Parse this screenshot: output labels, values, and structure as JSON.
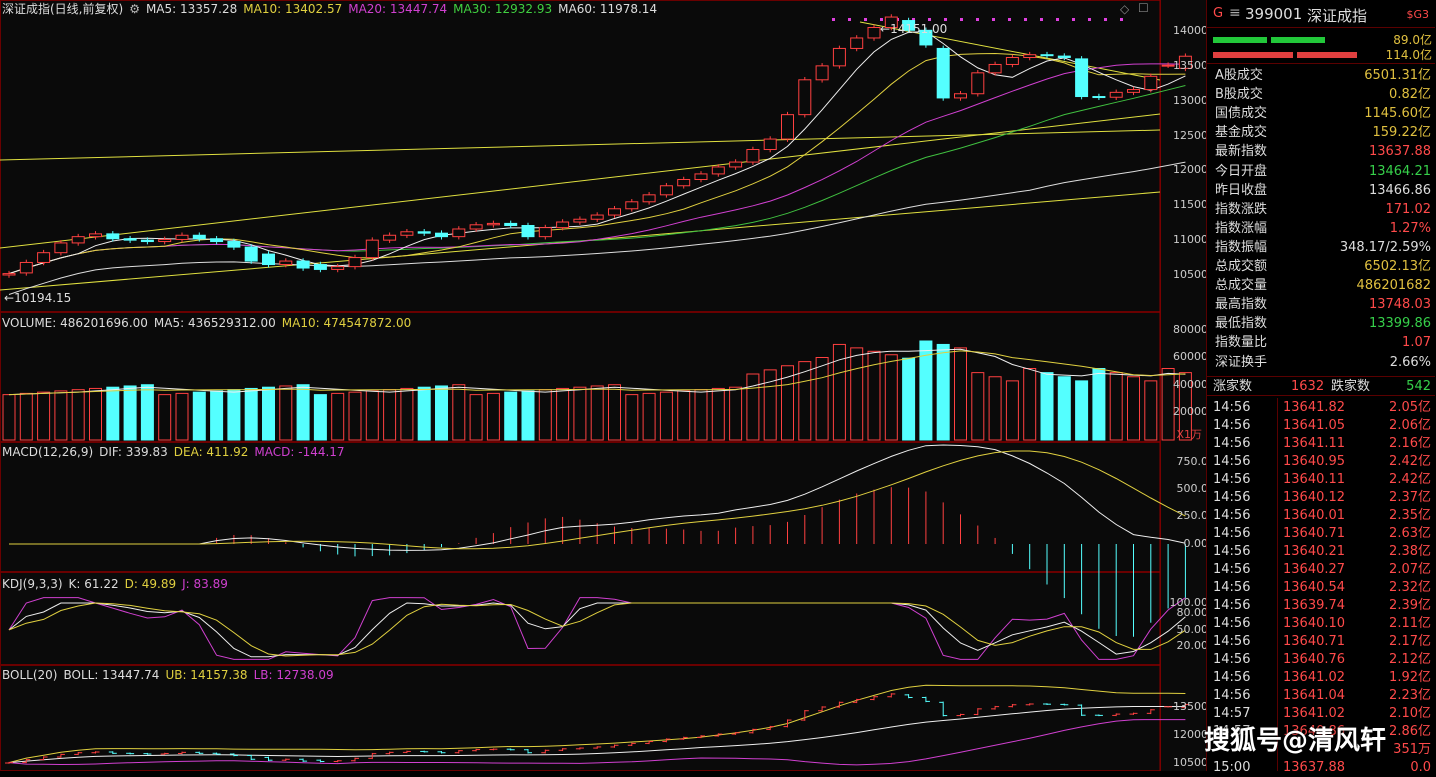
{
  "title": {
    "name": "深证成指(日线,前复权)",
    "ma5": "MA5: 13357.28",
    "ma10": "MA10: 13402.57",
    "ma20": "MA20: 13447.74",
    "ma30": "MA30: 12932.93",
    "ma60": "MA60: 11978.14"
  },
  "price_axis": [
    "14000",
    "13500",
    "13000",
    "12500",
    "12000",
    "11500",
    "11000",
    "10500"
  ],
  "high_label": "14151.00",
  "low_label": "10194.15",
  "volume": {
    "title": "VOLUME: 486201696.00",
    "ma5": "MA5: 436529312.00",
    "ma10": "MA10: 474547872.00",
    "axis": [
      "80000",
      "60000",
      "40000",
      "20000"
    ],
    "unit": "X1万"
  },
  "macd": {
    "title": "MACD(12,26,9)",
    "dif": "DIF: 339.83",
    "dea": "DEA: 411.92",
    "macd": "MACD: -144.17",
    "axis": [
      "750.0",
      "500.0",
      "250.0",
      "0.00"
    ]
  },
  "kdj": {
    "title": "KDJ(9,3,3)",
    "k": "K: 61.22",
    "d": "D: 49.89",
    "j": "J: 83.89",
    "axis": [
      "100.00",
      "80.00",
      "50.00",
      "20.00"
    ]
  },
  "boll": {
    "title": "BOLL(20)",
    "boll": "BOLL: 13447.74",
    "ub": "UB: 14157.38",
    "lb": "LB: 12738.09",
    "axis": [
      "13500",
      "12000",
      "10500"
    ]
  },
  "side": {
    "header": {
      "g": "G",
      "menu": "≡",
      "code": "399001",
      "name": "深证成指",
      "badge": "$G3"
    },
    "bars": {
      "top": "89.0亿",
      "bottom": "114.0亿"
    },
    "stats": [
      {
        "k": "A股成交",
        "v": "6501.31亿",
        "c": "#e0c040"
      },
      {
        "k": "B股成交",
        "v": "0.82亿",
        "c": "#e0c040"
      },
      {
        "k": "国债成交",
        "v": "1145.60亿",
        "c": "#e0c040"
      },
      {
        "k": "基金成交",
        "v": "159.22亿",
        "c": "#e0c040"
      },
      {
        "k": "最新指数",
        "v": "13637.88",
        "c": "#ff4a4a"
      },
      {
        "k": "今日开盘",
        "v": "13464.21",
        "c": "#36d04a"
      },
      {
        "k": "昨日收盘",
        "v": "13466.86",
        "c": "#ddd"
      },
      {
        "k": "指数涨跌",
        "v": "171.02",
        "c": "#ff4a4a"
      },
      {
        "k": "指数涨幅",
        "v": "1.27%",
        "c": "#ff4a4a"
      },
      {
        "k": "指数振幅",
        "v": "348.17/2.59%",
        "c": "#ddd"
      },
      {
        "k": "总成交额",
        "v": "6502.13亿",
        "c": "#e0c040"
      },
      {
        "k": "总成交量",
        "v": "486201682",
        "c": "#e0c040"
      },
      {
        "k": "最高指数",
        "v": "13748.03",
        "c": "#ff4a4a"
      },
      {
        "k": "最低指数",
        "v": "13399.86",
        "c": "#36d04a"
      },
      {
        "k": "指数量比",
        "v": "1.07",
        "c": "#ff4a4a"
      },
      {
        "k": "深证换手",
        "v": "2.66%",
        "c": "#ddd"
      }
    ],
    "updown": {
      "up_label": "涨家数",
      "up": "1632",
      "down_label": "跌家数",
      "down": "542"
    },
    "ticks": [
      [
        "14:56",
        "13641.82",
        "2.05亿"
      ],
      [
        "14:56",
        "13641.05",
        "2.06亿"
      ],
      [
        "14:56",
        "13641.11",
        "2.16亿"
      ],
      [
        "14:56",
        "13640.95",
        "2.42亿"
      ],
      [
        "14:56",
        "13640.11",
        "2.42亿"
      ],
      [
        "14:56",
        "13640.12",
        "2.37亿"
      ],
      [
        "14:56",
        "13640.01",
        "2.35亿"
      ],
      [
        "14:56",
        "13640.71",
        "2.63亿"
      ],
      [
        "14:56",
        "13640.21",
        "2.38亿"
      ],
      [
        "14:56",
        "13640.27",
        "2.07亿"
      ],
      [
        "14:56",
        "13640.54",
        "2.32亿"
      ],
      [
        "14:56",
        "13639.74",
        "2.39亿"
      ],
      [
        "14:56",
        "13640.10",
        "2.11亿"
      ],
      [
        "14:56",
        "13640.71",
        "2.17亿"
      ],
      [
        "14:56",
        "13640.76",
        "2.12亿"
      ],
      [
        "14:56",
        "13641.02",
        "1.92亿"
      ],
      [
        "14:56",
        "13641.04",
        "2.23亿"
      ],
      [
        "14:57",
        "13641.02",
        "2.10亿"
      ],
      [
        "14:57",
        "13640.86",
        "2.86亿"
      ],
      [
        "",
        "",
        "351万"
      ],
      [
        "15:00",
        "13637.88",
        "0.0"
      ]
    ]
  },
  "watermark": "搜狐号@清风轩",
  "chart_data": {
    "type": "candlestick",
    "closes": [
      10520,
      10680,
      10820,
      10960,
      11050,
      11090,
      11020,
      11000,
      10980,
      11010,
      11070,
      11020,
      10980,
      10900,
      10700,
      10650,
      10700,
      10600,
      10580,
      10620,
      10750,
      11000,
      11070,
      11120,
      11100,
      11050,
      11160,
      11220,
      11240,
      11210,
      11050,
      11180,
      11260,
      11300,
      11360,
      11450,
      11550,
      11650,
      11780,
      11870,
      11950,
      12050,
      12120,
      12300,
      12450,
      12800,
      13300,
      13500,
      13750,
      13900,
      14050,
      14200,
      14010,
      13800,
      13040,
      13100,
      13400,
      13520,
      13620,
      13660,
      13650,
      13620,
      13060,
      13050,
      13120,
      13160,
      13350,
      13510,
      13638
    ],
    "opens": [
      10500,
      10530,
      10680,
      10820,
      10960,
      11050,
      11090,
      11020,
      11000,
      10980,
      11010,
      11070,
      11020,
      10980,
      10900,
      10800,
      10650,
      10700,
      10650,
      10580,
      10620,
      10750,
      11000,
      11070,
      11120,
      11100,
      11050,
      11160,
      11220,
      11240,
      11210,
      11050,
      11180,
      11260,
      11300,
      11360,
      11450,
      11550,
      11650,
      11780,
      11870,
      11950,
      12050,
      12120,
      12300,
      12450,
      12800,
      13300,
      13500,
      13750,
      13900,
      14050,
      14150,
      14010,
      13750,
      13040,
      13100,
      13400,
      13520,
      13620,
      13660,
      13640,
      13600,
      13060,
      13050,
      13120,
      13160,
      13510,
      13464
    ]
  }
}
